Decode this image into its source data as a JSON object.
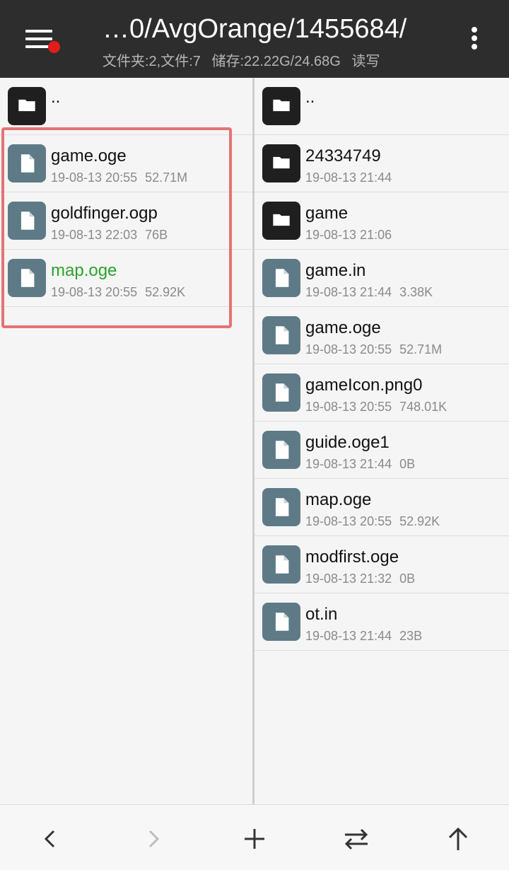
{
  "header": {
    "title": "…0/AvgOrange/1455684/",
    "stats": {
      "folders": "文件夹:2,文件:7",
      "storage": "储存:22.22G/24.68G",
      "mode": "读写"
    }
  },
  "left_pane": {
    "up_label": "..",
    "items": [
      {
        "name": "game.oge",
        "date": "19-08-13 20:55",
        "size": "52.71M"
      },
      {
        "name": "goldfinger.ogp",
        "date": "19-08-13 22:03",
        "size": "76B"
      },
      {
        "name": "map.oge",
        "date": "19-08-13 20:55",
        "size": "52.92K"
      }
    ]
  },
  "right_pane": {
    "up_label": "..",
    "items": [
      {
        "name": "24334749",
        "date": "19-08-13 21:44",
        "size": ""
      },
      {
        "name": "game",
        "date": "19-08-13 21:06",
        "size": ""
      },
      {
        "name": "game.in",
        "date": "19-08-13 21:44",
        "size": "3.38K"
      },
      {
        "name": "game.oge",
        "date": "19-08-13 20:55",
        "size": "52.71M"
      },
      {
        "name": "gameIcon.png0",
        "date": "19-08-13 20:55",
        "size": "748.01K"
      },
      {
        "name": "guide.oge1",
        "date": "19-08-13 21:44",
        "size": "0B"
      },
      {
        "name": "map.oge",
        "date": "19-08-13 20:55",
        "size": "52.92K"
      },
      {
        "name": "modfirst.oge",
        "date": "19-08-13 21:32",
        "size": "0B"
      },
      {
        "name": "ot.in",
        "date": "19-08-13 21:44",
        "size": "23B"
      }
    ]
  },
  "bottom_bar": {
    "icons": [
      "back-icon",
      "forward-icon",
      "add-icon",
      "swap-icon",
      "up-arrow-icon"
    ]
  },
  "colors": {
    "header_bg": "#2d2d2d",
    "accent_green": "#2aa32a",
    "file_icon": "#5e7a87",
    "folder_icon": "#1f1f1f",
    "highlight_border": "#e57373",
    "notification_dot": "#e21b1b"
  }
}
